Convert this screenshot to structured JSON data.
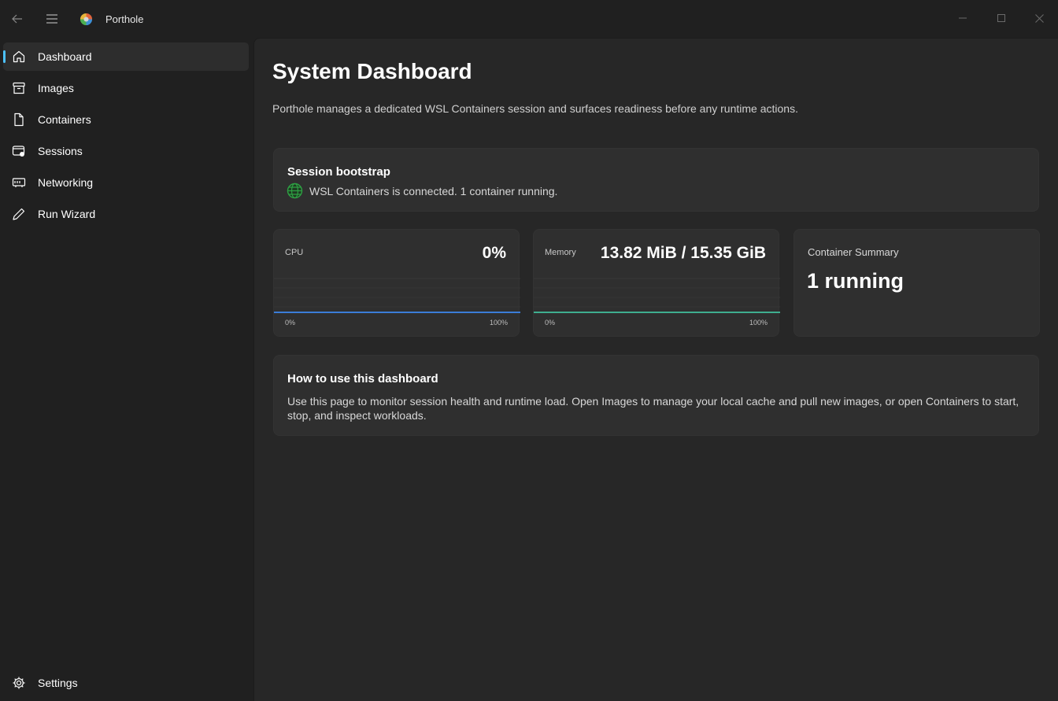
{
  "app": {
    "title": "Porthole"
  },
  "sidebar": {
    "items": [
      {
        "label": "Dashboard",
        "icon": "home-icon",
        "selected": true
      },
      {
        "label": "Images",
        "icon": "archive-box-icon"
      },
      {
        "label": "Containers",
        "icon": "document-icon"
      },
      {
        "label": "Sessions",
        "icon": "session-icon"
      },
      {
        "label": "Networking",
        "icon": "network-adapter-icon"
      },
      {
        "label": "Run Wizard",
        "icon": "pencil-icon"
      }
    ],
    "settings": {
      "label": "Settings",
      "icon": "gear-icon"
    },
    "accent": "#4cc2ff"
  },
  "page": {
    "title": "System Dashboard",
    "subtitle": "Porthole manages a dedicated WSL Containers session and surfaces readiness before any runtime actions."
  },
  "session": {
    "title": "Session bootstrap",
    "status": "WSL Containers is connected. 1 container running.",
    "status_icon": "globe-icon",
    "status_color": "#2ea043"
  },
  "metrics": {
    "cpu": {
      "label": "CPU",
      "value": "0%",
      "axis_min": "0%",
      "axis_max": "100%",
      "line_color": "#3b7dd8",
      "level": 0
    },
    "memory": {
      "label": "Memory",
      "value": "13.82 MiB / 15.35 GiB",
      "axis_min": "0%",
      "axis_max": "100%",
      "line_color": "#3fae8f",
      "level": 0
    }
  },
  "summary": {
    "label": "Container Summary",
    "value": "1 running"
  },
  "howto": {
    "title": "How to use this dashboard",
    "body": "Use this page to monitor session health and runtime load. Open Images to manage your local cache and pull new images, or open Containers to start, stop, and inspect workloads."
  }
}
